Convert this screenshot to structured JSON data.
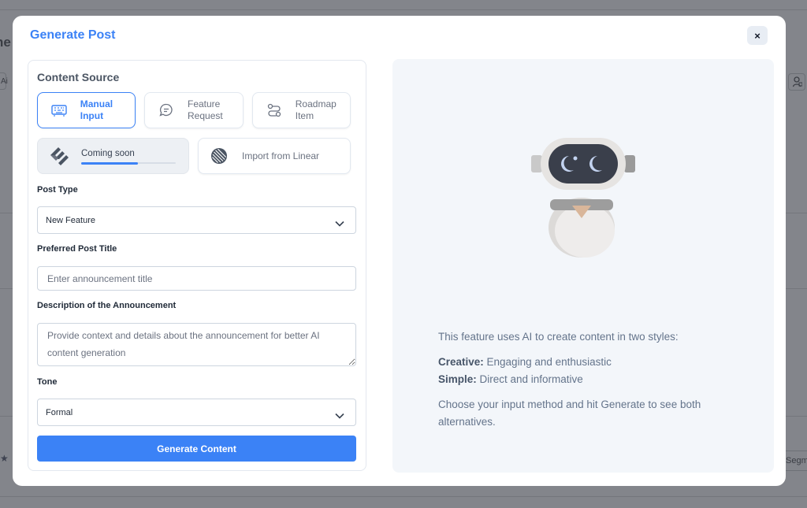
{
  "background": {
    "left_text": "ne",
    "left_chip": "Ai",
    "right_chip": "Segm"
  },
  "modal": {
    "title": "Generate Post",
    "close_label": "×",
    "content_source": {
      "title": "Content Source",
      "buttons": [
        {
          "label": "Manual Input",
          "icon": "keyboard-icon",
          "active": true
        },
        {
          "label": "Feature Request",
          "icon": "chat-bubble-icon",
          "active": false
        },
        {
          "label": "Roadmap Item",
          "icon": "roadmap-icon",
          "active": false
        }
      ],
      "coming_soon": {
        "label": "Coming soon",
        "icon": "jira-icon",
        "progress": 0.6
      },
      "import_linear": {
        "label": "Import from Linear",
        "icon": "linear-icon"
      }
    },
    "post_type": {
      "label": "Post Type",
      "value": "New Feature"
    },
    "preferred_title": {
      "label": "Preferred Post Title",
      "placeholder": "Enter announcement title"
    },
    "description": {
      "label": "Description of the Announcement",
      "placeholder": "Provide context and details about the announcement for better AI content generation"
    },
    "tone": {
      "label": "Tone",
      "value": "Formal"
    },
    "generate_label": "Generate Content",
    "info": {
      "intro": "This feature uses AI to create content in two styles:",
      "creative_label": "Creative:",
      "creative_text": " Engaging and enthusiastic",
      "simple_label": "Simple:",
      "simple_text": " Direct and informative",
      "outro": "Choose your input method and hit Generate to see both alternatives."
    }
  },
  "colors": {
    "accent": "#3b82f6",
    "overlay": "#83858b",
    "panel": "#f3f6fa"
  }
}
